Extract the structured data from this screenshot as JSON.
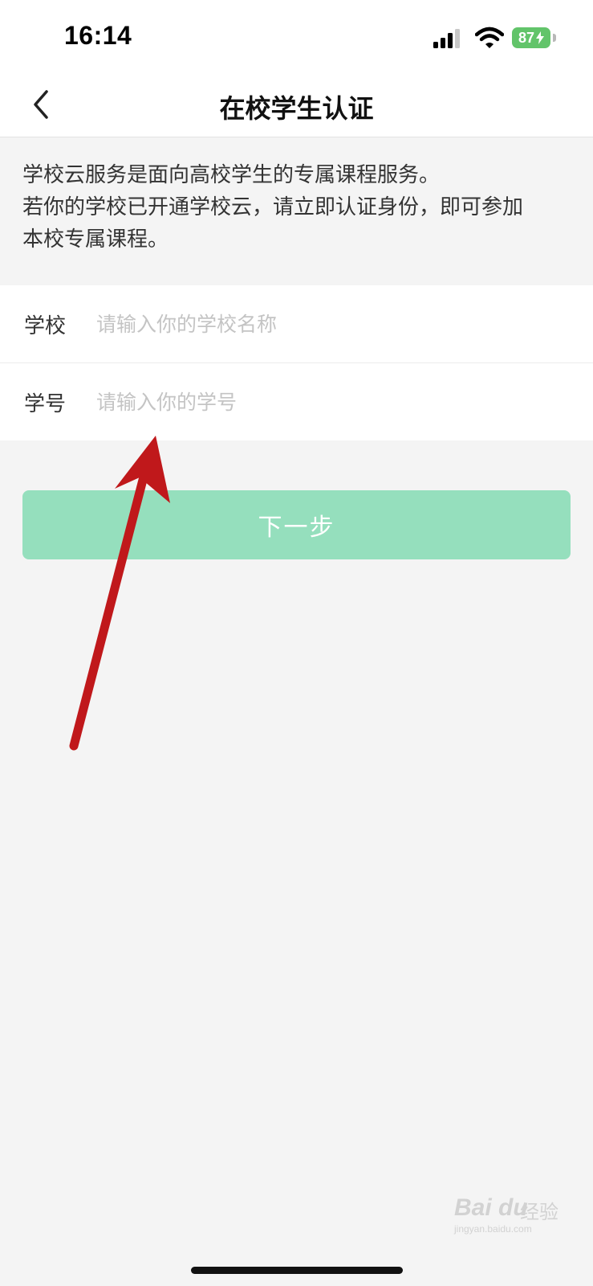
{
  "status_bar": {
    "time": "16:14",
    "battery": "87",
    "icons": [
      "cellular-signal-icon",
      "wifi-icon",
      "battery-charging-icon"
    ]
  },
  "nav": {
    "title": "在校学生认证",
    "back_icon": "chevron-left-icon"
  },
  "intro": {
    "lines": [
      "学校云服务是面向高校学生的专属课程服务。",
      "若你的学校已开通学校云，请立即认证身份，即可参加",
      "本校专属课程。"
    ]
  },
  "form": {
    "fields": [
      {
        "label": "学校",
        "value": "",
        "placeholder": "请输入你的学校名称"
      },
      {
        "label": "学号",
        "value": "",
        "placeholder": "请输入你的学号"
      }
    ]
  },
  "next_button": {
    "label": "下一步",
    "enabled": false
  },
  "annotation": {
    "type": "arrow",
    "color": "#c0181b"
  },
  "watermark": {
    "brand": "Bai du",
    "text": "经验",
    "url": "jingyan.baidu.com"
  },
  "colors": {
    "accent_disabled": "#95dfbd",
    "background": "#f4f4f4",
    "battery": "#62c46a"
  }
}
